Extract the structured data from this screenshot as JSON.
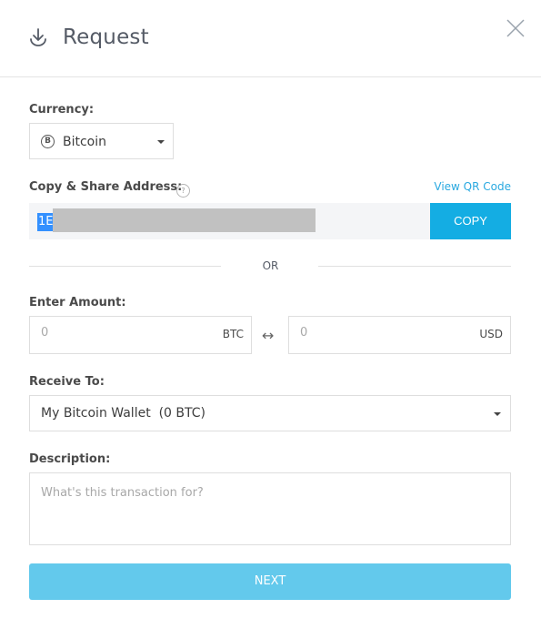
{
  "header": {
    "title": "Request",
    "title_icon": "download-icon",
    "close_icon": "close-icon"
  },
  "currency": {
    "label": "Currency:",
    "selected": "Bitcoin",
    "coin_symbol": "B",
    "icon": "bitcoin-icon"
  },
  "address": {
    "label": "Copy & Share Address:",
    "help_symbol": "?",
    "view_qr_label": "View QR Code",
    "value_visible": "1E",
    "redacted": true,
    "copy_label": "COPY"
  },
  "divider": {
    "label": "OR"
  },
  "amount": {
    "label": "Enter Amount:",
    "btc": {
      "placeholder": "0",
      "unit": "BTC"
    },
    "usd": {
      "placeholder": "0",
      "unit": "USD"
    },
    "swap_symbol": "↔"
  },
  "receive_to": {
    "label": "Receive To:",
    "selected": "My Bitcoin Wallet  (0 BTC)"
  },
  "description": {
    "label": "Description:",
    "placeholder": "What's this transaction for?"
  },
  "actions": {
    "next_label": "NEXT"
  },
  "colors": {
    "accent": "#14ade3",
    "next_disabled": "#63c9ec",
    "link": "#2aa9e0",
    "selection": "#3390ff"
  }
}
